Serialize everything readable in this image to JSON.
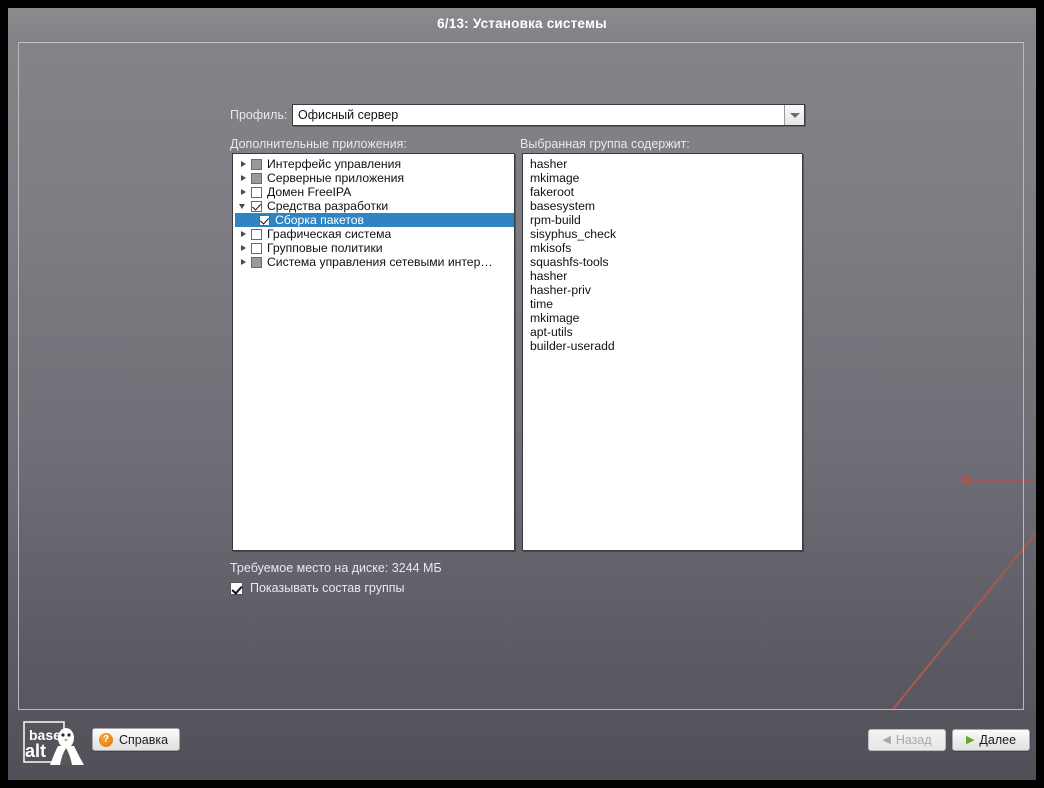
{
  "window": {
    "title": "6/13: Установка системы"
  },
  "form": {
    "profile_label": "Профиль:",
    "profile_value": "Офисный сервер",
    "profile_arrow_icon": "chevron-down-icon",
    "left_caption": "Дополнительные приложения:",
    "right_caption": "Выбранная группа содержит:",
    "disk_space_text": "Требуемое место на диске: 3244 МБ",
    "show_group_label": "Показывать состав группы",
    "show_group_checked": true
  },
  "tree": {
    "items": [
      {
        "label": "Интерфейс управления",
        "state": "partial",
        "expander": "collapsed",
        "level": 0,
        "selected": false
      },
      {
        "label": "Серверные приложения",
        "state": "partial",
        "expander": "collapsed",
        "level": 0,
        "selected": false
      },
      {
        "label": "Домен FreeIPA",
        "state": "unchecked",
        "expander": "collapsed",
        "level": 0,
        "selected": false
      },
      {
        "label": "Средства разработки",
        "state": "checked",
        "expander": "expanded",
        "level": 0,
        "selected": false
      },
      {
        "label": "Сборка пакетов",
        "state": "checked",
        "expander": "none",
        "level": 1,
        "selected": true
      },
      {
        "label": "Графическая система",
        "state": "unchecked",
        "expander": "collapsed",
        "level": 0,
        "selected": false
      },
      {
        "label": "Групповые политики",
        "state": "unchecked",
        "expander": "collapsed",
        "level": 0,
        "selected": false
      },
      {
        "label": "Система управления сетевыми интер…",
        "state": "partial",
        "expander": "collapsed",
        "level": 0,
        "selected": false
      }
    ]
  },
  "packages": {
    "items": [
      "hasher",
      "mkimage",
      "fakeroot",
      "basesystem",
      "rpm-build",
      "sisyphus_check",
      "mkisofs",
      "squashfs-tools",
      "hasher",
      "hasher-priv",
      "time",
      "mkimage",
      "apt-utils",
      "builder-useradd"
    ]
  },
  "buttons": {
    "help": {
      "label": "Справка",
      "icon": "question-mark-icon"
    },
    "back": {
      "label": "Назад",
      "icon": "chevron-left-icon",
      "disabled": true
    },
    "next": {
      "label": "Далее",
      "icon": "chevron-right-icon",
      "disabled": false
    }
  },
  "logo": {
    "line1": "base",
    "line2": "alt"
  },
  "colors": {
    "selection": "#2f84c4",
    "accent_orange": "#e8881a",
    "accent_green": "#63a82b",
    "decor_line": "#a15a52"
  }
}
